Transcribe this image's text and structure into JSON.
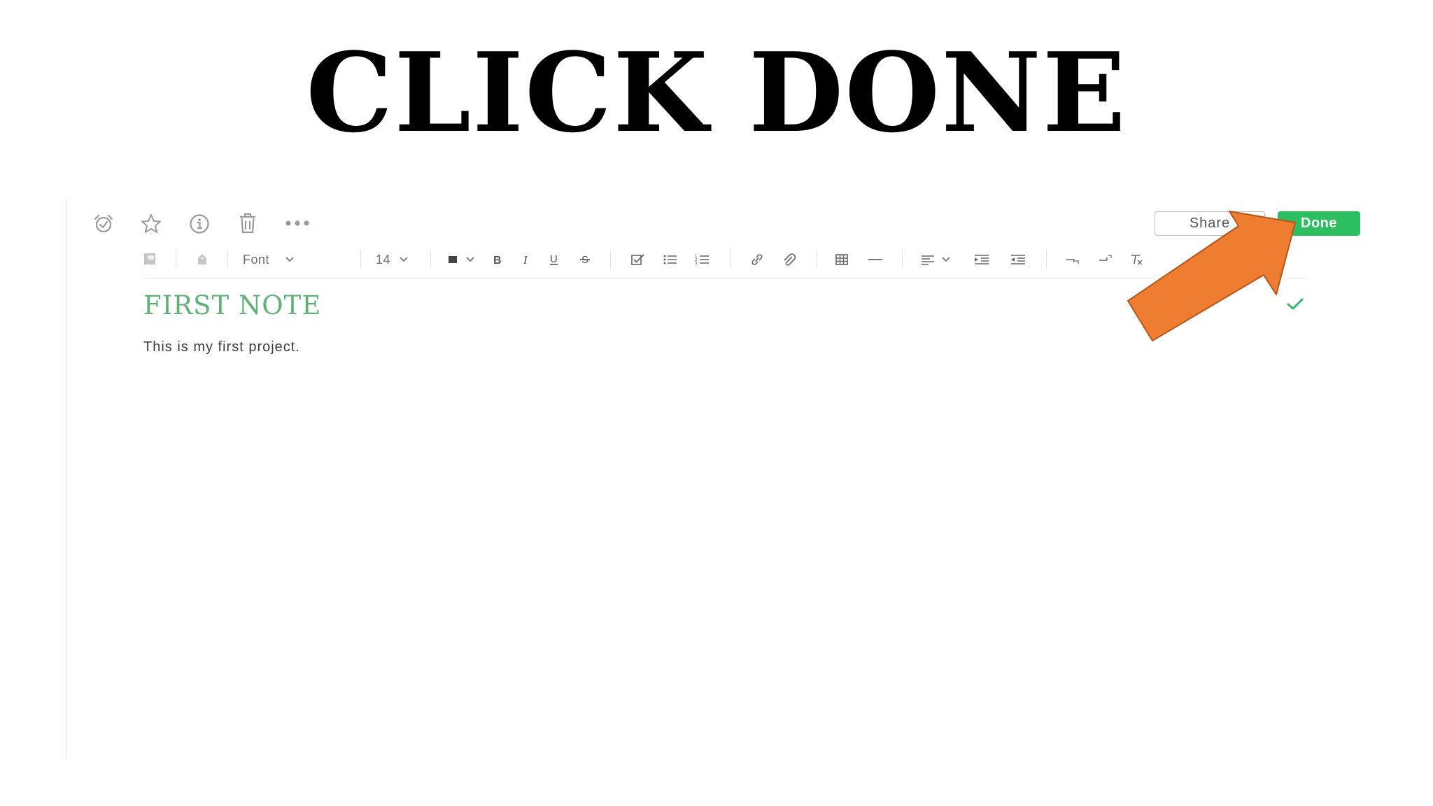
{
  "headline": "CLICK DONE",
  "topbar": {
    "icons": [
      "reminder-icon",
      "star-icon",
      "info-icon",
      "trash-icon",
      "more-icon"
    ],
    "share_label": "Share",
    "done_label": "Done"
  },
  "format_toolbar": {
    "font_label": "Font",
    "font_size": "14"
  },
  "note": {
    "title": "FIRST NOTE",
    "body": "This is my first project."
  },
  "colors": {
    "done_button": "#2dbe60",
    "note_title": "#5fb176",
    "arrow_fill": "#ef7d31",
    "arrow_stroke": "#b5561a"
  }
}
